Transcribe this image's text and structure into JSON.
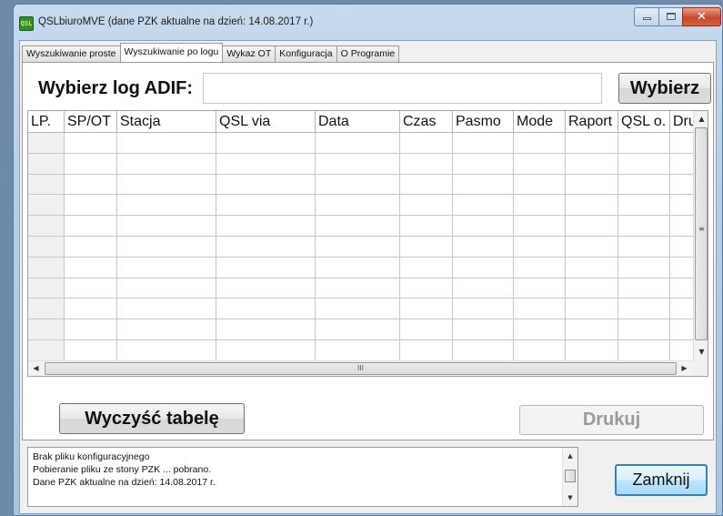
{
  "window": {
    "title": "QSLbiuroMVE (dane PZK aktualne na dzień: 14.08.2017 r.)",
    "icon_text": "QSL",
    "controls": {
      "minimize": "minimize-icon",
      "maximize": "maximize-icon",
      "close": "close-icon",
      "close_glyph": "✕"
    }
  },
  "tabs": [
    {
      "label": "Wyszukiwanie proste",
      "active": false
    },
    {
      "label": "Wyszukiwanie po logu",
      "active": true
    },
    {
      "label": "Wykaz OT",
      "active": false
    },
    {
      "label": "Konfiguracja",
      "active": false
    },
    {
      "label": "O Programie",
      "active": false
    }
  ],
  "adif": {
    "label": "Wybierz log ADIF:",
    "input_value": "",
    "button_label": "Wybierz"
  },
  "table": {
    "columns": [
      "LP.",
      "SP/OT",
      "Stacja",
      "QSL via",
      "Data",
      "Czas",
      "Pasmo",
      "Mode",
      "Raport",
      "QSL o.",
      "Druk"
    ],
    "rows": [],
    "empty_row_count": 11,
    "scroll_glyphs": {
      "up": "▲",
      "down": "▼",
      "left": "◀",
      "right": "▶",
      "v_grip": "≡",
      "h_grip": "III"
    }
  },
  "actions": {
    "clear_label": "Wyczyść tabelę",
    "print_label": "Drukuj",
    "print_enabled": false
  },
  "log": {
    "lines": [
      "Brak pliku konfiguracyjnego",
      "Pobieranie pliku ze stony PZK ... pobrano.",
      "Dane PZK aktualne na dzień: 14.08.2017 r."
    ]
  },
  "close_button_label": "Zamknij"
}
